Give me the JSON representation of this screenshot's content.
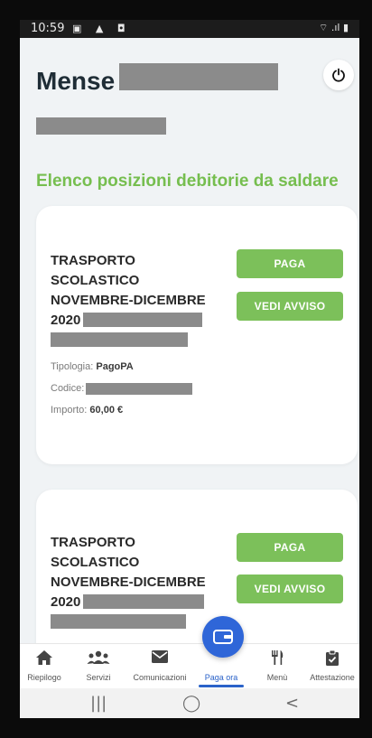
{
  "status_bar": {
    "time": "10:59",
    "icons": "▣ ▲ ◘",
    "signal": "⌔ .ıl ▮"
  },
  "header": {
    "title": "Mense"
  },
  "section": {
    "title": "Elenco posizioni debitorie da saldare"
  },
  "cards": [
    {
      "title_lines": [
        "TRASPORTO",
        "SCOLASTICO",
        "NOVEMBRE-DICEMBRE",
        "2020"
      ],
      "pay_label": "PAGA",
      "view_label": "VEDI AVVISO",
      "tipologia_label": "Tipologia:",
      "tipologia_value": "PagoPA",
      "codice_label": "Codice:",
      "importo_label": "Importo:",
      "importo_value": "60,00 €"
    },
    {
      "title_lines": [
        "TRASPORTO",
        "SCOLASTICO",
        "NOVEMBRE-DICEMBRE",
        "2020"
      ],
      "pay_label": "PAGA",
      "view_label": "VEDI AVVISO"
    }
  ],
  "bottom_nav": {
    "items": [
      {
        "label": "Riepilogo",
        "icon": "home-icon"
      },
      {
        "label": "Servizi",
        "icon": "people-icon"
      },
      {
        "label": "Comunicazioni",
        "icon": "mail-icon"
      },
      {
        "label": "Paga ora",
        "icon": "wallet-icon"
      },
      {
        "label": "Menù",
        "icon": "cutlery-icon"
      },
      {
        "label": "Attestazione",
        "icon": "clipboard-check-icon"
      }
    ],
    "active": "Paga ora"
  },
  "android_nav": {
    "recents": "|||",
    "home": "◯",
    "back": "<"
  },
  "colors": {
    "accent_green": "#76be4f",
    "button_green": "#7cc05a",
    "active_blue": "#2a62c9",
    "title_dark": "#1f2d36"
  }
}
